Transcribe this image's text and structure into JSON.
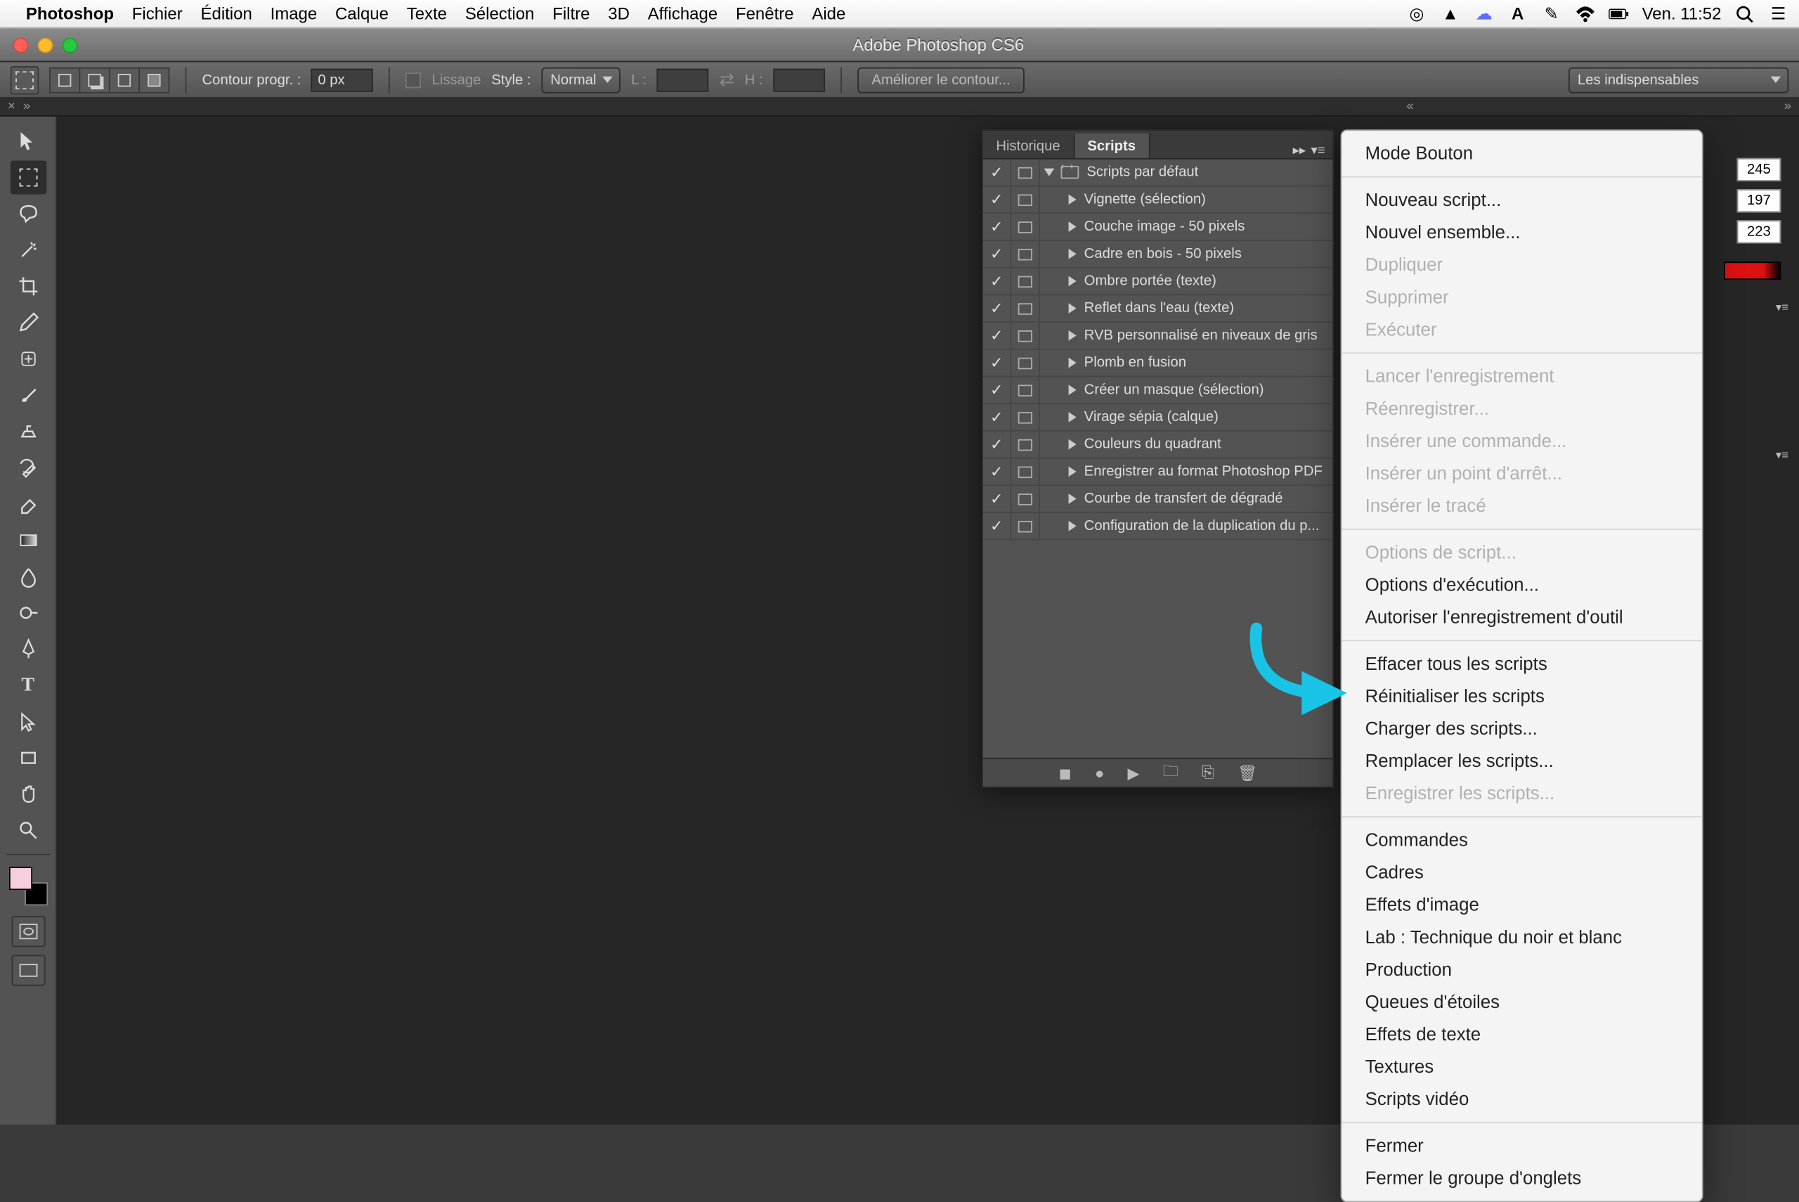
{
  "mac_menu": {
    "app_name": "Photoshop",
    "items": [
      "Fichier",
      "Édition",
      "Image",
      "Calque",
      "Texte",
      "Sélection",
      "Filtre",
      "3D",
      "Affichage",
      "Fenêtre",
      "Aide"
    ],
    "clock": "Ven. 11:52"
  },
  "window": {
    "title": "Adobe Photoshop CS6"
  },
  "options_bar": {
    "feather_label": "Contour progr. :",
    "feather_value": "0 px",
    "antialias_label": "Lissage",
    "style_label": "Style :",
    "style_value": "Normal",
    "width_label": "L :",
    "height_label": "H :",
    "refine_label": "Améliorer le contour...",
    "workspace_value": "Les indispensables"
  },
  "panel": {
    "tabs": [
      "Historique",
      "Scripts"
    ],
    "active_tab": 1,
    "set_label": "Scripts par défaut",
    "scripts": [
      "Vignette (sélection)",
      "Couche image - 50 pixels",
      "Cadre en bois - 50 pixels",
      "Ombre portée (texte)",
      "Reflet dans l'eau (texte)",
      "RVB personnalisé en niveaux de gris",
      "Plomb en fusion",
      "Créer un masque (sélection)",
      "Virage sépia (calque)",
      "Couleurs du quadrant",
      "Enregistrer au format Photoshop PDF",
      "Courbe de transfert de dégradé",
      "Configuration de la duplication du p..."
    ]
  },
  "ctx_menu": {
    "groups": [
      [
        {
          "t": "Mode Bouton",
          "d": false
        }
      ],
      [
        {
          "t": "Nouveau script...",
          "d": false
        },
        {
          "t": "Nouvel ensemble...",
          "d": false
        },
        {
          "t": "Dupliquer",
          "d": true
        },
        {
          "t": "Supprimer",
          "d": true
        },
        {
          "t": "Exécuter",
          "d": true
        }
      ],
      [
        {
          "t": "Lancer l'enregistrement",
          "d": true
        },
        {
          "t": "Réenregistrer...",
          "d": true
        },
        {
          "t": "Insérer une commande...",
          "d": true
        },
        {
          "t": "Insérer un point d'arrêt...",
          "d": true
        },
        {
          "t": "Insérer le tracé",
          "d": true
        }
      ],
      [
        {
          "t": "Options de script...",
          "d": true
        },
        {
          "t": "Options d'exécution...",
          "d": false
        },
        {
          "t": "Autoriser l'enregistrement d'outil",
          "d": false
        }
      ],
      [
        {
          "t": "Effacer tous les scripts",
          "d": false
        },
        {
          "t": "Réinitialiser les scripts",
          "d": false
        },
        {
          "t": "Charger des scripts...",
          "d": false
        },
        {
          "t": "Remplacer les scripts...",
          "d": false
        },
        {
          "t": "Enregistrer les scripts...",
          "d": true
        }
      ],
      [
        {
          "t": "Commandes",
          "d": false
        },
        {
          "t": "Cadres",
          "d": false
        },
        {
          "t": "Effets d'image",
          "d": false
        },
        {
          "t": "Lab : Technique du noir et blanc",
          "d": false
        },
        {
          "t": "Production",
          "d": false
        },
        {
          "t": "Queues d'étoiles",
          "d": false
        },
        {
          "t": "Effets de texte",
          "d": false
        },
        {
          "t": "Textures",
          "d": false
        },
        {
          "t": "Scripts vidéo",
          "d": false
        }
      ],
      [
        {
          "t": "Fermer",
          "d": false
        },
        {
          "t": "Fermer le groupe d'onglets",
          "d": false
        }
      ]
    ]
  },
  "rgb": {
    "r": "245",
    "g": "197",
    "b": "223"
  }
}
